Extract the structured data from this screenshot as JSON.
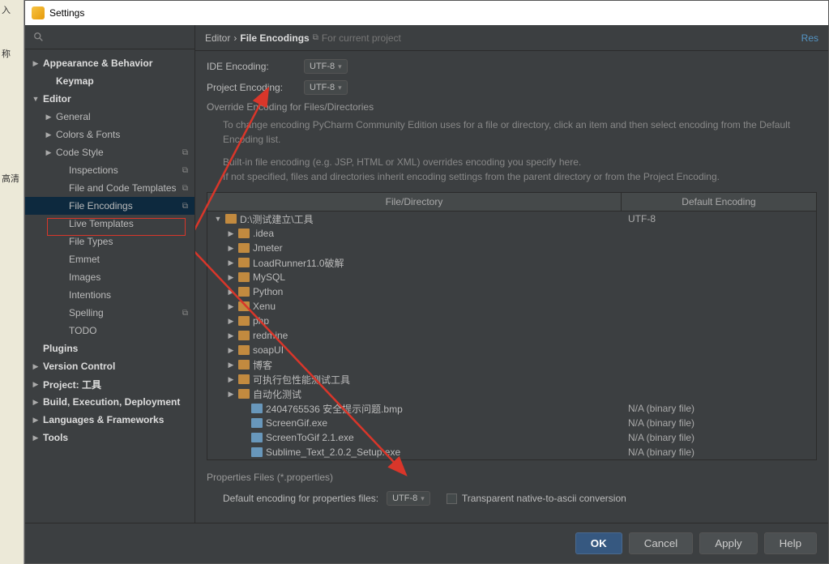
{
  "leftStrip": {
    "l1": "入",
    "l2": "称",
    "l3": "高清"
  },
  "window": {
    "title": "Settings"
  },
  "sidebar": {
    "items": [
      {
        "label": "Appearance & Behavior",
        "exp": "▶",
        "bold": true
      },
      {
        "label": "Keymap",
        "d": 1,
        "bold": true
      },
      {
        "label": "Editor",
        "exp": "▼",
        "bold": true
      },
      {
        "label": "General",
        "exp": "▶",
        "d": 1
      },
      {
        "label": "Colors & Fonts",
        "exp": "▶",
        "d": 1
      },
      {
        "label": "Code Style",
        "exp": "▶",
        "d": 1,
        "cp": true
      },
      {
        "label": "Inspections",
        "d": 2,
        "cp": true
      },
      {
        "label": "File and Code Templates",
        "d": 2,
        "cp": true
      },
      {
        "label": "File Encodings",
        "d": 2,
        "sel": true,
        "cp": true
      },
      {
        "label": "Live Templates",
        "d": 2
      },
      {
        "label": "File Types",
        "d": 2
      },
      {
        "label": "Emmet",
        "d": 2
      },
      {
        "label": "Images",
        "d": 2
      },
      {
        "label": "Intentions",
        "d": 2
      },
      {
        "label": "Spelling",
        "d": 2,
        "cp": true
      },
      {
        "label": "TODO",
        "d": 2
      },
      {
        "label": "Plugins",
        "bold": true
      },
      {
        "label": "Version Control",
        "exp": "▶",
        "bold": true
      },
      {
        "label": "Project: 工具",
        "exp": "▶",
        "bold": true
      },
      {
        "label": "Build, Execution, Deployment",
        "exp": "▶",
        "bold": true
      },
      {
        "label": "Languages & Frameworks",
        "exp": "▶",
        "bold": true
      },
      {
        "label": "Tools",
        "exp": "▶",
        "bold": true
      }
    ]
  },
  "breadcrumb": {
    "a": "Editor",
    "b": "File Encodings",
    "sub": "For current project",
    "reset": "Res"
  },
  "panel": {
    "ideEncoding": {
      "label": "IDE Encoding:",
      "value": "UTF-8"
    },
    "projectEncoding": {
      "label": "Project Encoding:",
      "value": "UTF-8"
    },
    "overrideTitle": "Override Encoding for Files/Directories",
    "hint1": "To change encoding PyCharm Community Edition uses for a file or directory, click an item and then select encoding from the Default Encoding list.",
    "hint2a": "Built-in file encoding (e.g. JSP, HTML or XML) overrides encoding you specify here.",
    "hint2b": "If not specified, files and directories inherit encoding settings from the parent directory or from the Project Encoding.",
    "th1": "File/Directory",
    "th2": "Default Encoding",
    "rows": [
      {
        "exp": "▼",
        "ico": "folder",
        "ind": 0,
        "name": "D:\\测试建立\\工具",
        "enc": "UTF-8"
      },
      {
        "exp": "▶",
        "ico": "folder",
        "ind": 1,
        "name": ".idea"
      },
      {
        "exp": "▶",
        "ico": "folder",
        "ind": 1,
        "name": "Jmeter"
      },
      {
        "exp": "▶",
        "ico": "folder",
        "ind": 1,
        "name": "LoadRunner11.0破解"
      },
      {
        "exp": "▶",
        "ico": "folder",
        "ind": 1,
        "name": "MySQL"
      },
      {
        "exp": "▶",
        "ico": "folder",
        "ind": 1,
        "name": "Python"
      },
      {
        "exp": "▶",
        "ico": "folder",
        "ind": 1,
        "name": "Xenu"
      },
      {
        "exp": "▶",
        "ico": "folder",
        "ind": 1,
        "name": "php"
      },
      {
        "exp": "▶",
        "ico": "folder",
        "ind": 1,
        "name": "redmine"
      },
      {
        "exp": "▶",
        "ico": "folder",
        "ind": 1,
        "name": "soapUI"
      },
      {
        "exp": "▶",
        "ico": "folder",
        "ind": 1,
        "name": "博客"
      },
      {
        "exp": "▶",
        "ico": "folder",
        "ind": 1,
        "name": "可执行包性能测试工具"
      },
      {
        "exp": "▶",
        "ico": "folder",
        "ind": 1,
        "name": "自动化测试"
      },
      {
        "ico": "file",
        "ind": 2,
        "name": "2404765536 安全提示问题.bmp",
        "enc": "N/A (binary file)"
      },
      {
        "ico": "file",
        "ind": 2,
        "name": "ScreenGif.exe",
        "enc": "N/A (binary file)"
      },
      {
        "ico": "file",
        "ind": 2,
        "name": "ScreenToGif 2.1.exe",
        "enc": "N/A (binary file)"
      },
      {
        "ico": "file",
        "ind": 2,
        "name": "Sublime_Text_2.0.2_Setup.exe",
        "enc": "N/A (binary file)"
      }
    ],
    "propsTitle": "Properties Files (*.properties)",
    "propsLabel": "Default encoding for properties files:",
    "propsValue": "UTF-8",
    "cbLabel": "Transparent native-to-ascii conversion"
  },
  "buttons": {
    "ok": "OK",
    "cancel": "Cancel",
    "apply": "Apply",
    "help": "Help"
  }
}
